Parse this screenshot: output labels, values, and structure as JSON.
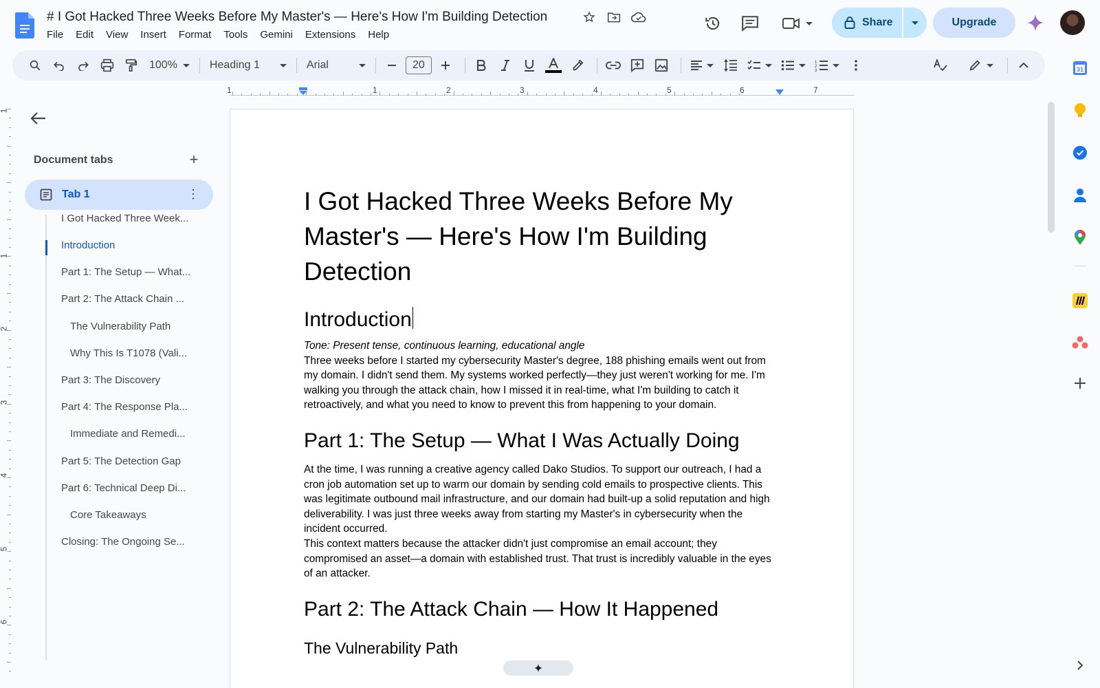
{
  "doc": {
    "title": "# I Got Hacked Three Weeks Before My Master's — Here's How I'm Building Detection"
  },
  "menu": [
    "File",
    "Edit",
    "View",
    "Insert",
    "Format",
    "Tools",
    "Gemini",
    "Extensions",
    "Help"
  ],
  "header": {
    "share_label": "Share",
    "upgrade_label": "Upgrade"
  },
  "toolbar": {
    "zoom": "100%",
    "style": "Heading 1",
    "font": "Arial",
    "font_size": "20"
  },
  "ruler": {
    "h_numbers": [
      "1",
      "1",
      "2",
      "3",
      "4",
      "5",
      "6",
      "7"
    ],
    "v_numbers": [
      "1",
      "1",
      "2",
      "3",
      "4",
      "5",
      "6"
    ]
  },
  "sidebar": {
    "heading": "Document tabs",
    "tab_label": "Tab 1",
    "outline": [
      {
        "label": "I Got Hacked Three Week...",
        "level": 1,
        "active": false
      },
      {
        "label": "Introduction",
        "level": 1,
        "active": true
      },
      {
        "label": "Part 1: The Setup — What...",
        "level": 1,
        "active": false
      },
      {
        "label": "Part 2: The Attack Chain ...",
        "level": 1,
        "active": false
      },
      {
        "label": "The Vulnerability Path",
        "level": 2,
        "active": false
      },
      {
        "label": "Why This Is T1078 (Vali...",
        "level": 2,
        "active": false
      },
      {
        "label": "Part 3: The Discovery",
        "level": 1,
        "active": false
      },
      {
        "label": "Part 4: The Response Pla...",
        "level": 1,
        "active": false
      },
      {
        "label": "Immediate and Remedi...",
        "level": 2,
        "active": false
      },
      {
        "label": "Part 5: The Detection Gap",
        "level": 1,
        "active": false
      },
      {
        "label": "Part 6: Technical Deep Di...",
        "level": 1,
        "active": false
      },
      {
        "label": "Core Takeaways",
        "level": 2,
        "active": false
      },
      {
        "label": "Closing: The Ongoing Se...",
        "level": 1,
        "active": false
      }
    ]
  },
  "content": {
    "title": "I Got Hacked Three Weeks Before My Master's — Here's How I'm Building Detection",
    "intro_heading": "Introduction",
    "tone": "Tone: Present tense, continuous learning, educational angle",
    "intro_para": "Three weeks before I started my cybersecurity Master's degree, 188 phishing emails went out from my domain. I didn't send them. My systems worked perfectly—they just weren't working for me. I'm walking you through the attack chain, how I missed it in real-time, what I'm building to catch it retroactively, and what you need to know to prevent this from happening to your domain.",
    "part1_heading": "Part 1: The Setup — What I Was Actually Doing",
    "part1_para1": "At the time, I was running a creative agency called Dako Studios. To support our outreach, I had a cron job automation set up to warm our domain by sending cold emails to prospective clients. This was legitimate outbound mail infrastructure, and our domain had built-up a solid reputation and high deliverability. I was just three weeks away from starting my Master's in cybersecurity when the incident occurred.",
    "part1_para2": "This context matters because the attacker didn't just compromise an email account; they compromised an asset—a domain with established trust. That trust is incredibly valuable in the eyes of an attacker.",
    "part2_heading": "Part 2: The Attack Chain — How It Happened",
    "vuln_heading": "The Vulnerability Path"
  },
  "colors": {
    "accent": "#0b57d0",
    "share_bg": "#c2e7ff",
    "toolbar_bg": "#edf2fa"
  }
}
